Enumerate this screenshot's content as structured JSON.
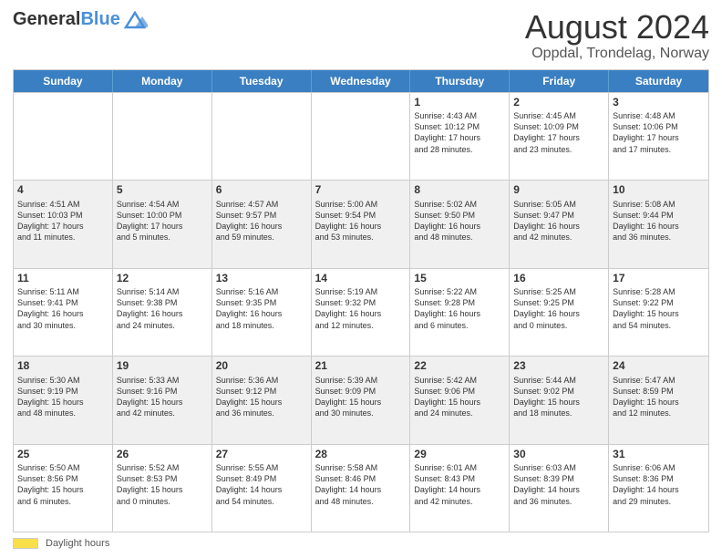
{
  "header": {
    "logo_line1": "General",
    "logo_line2": "Blue",
    "title": "August 2024",
    "subtitle": "Oppdal, Trondelag, Norway"
  },
  "days_of_week": [
    "Sunday",
    "Monday",
    "Tuesday",
    "Wednesday",
    "Thursday",
    "Friday",
    "Saturday"
  ],
  "footer": {
    "swatch_label": "Daylight hours"
  },
  "weeks": [
    [
      {
        "num": "",
        "info": ""
      },
      {
        "num": "",
        "info": ""
      },
      {
        "num": "",
        "info": ""
      },
      {
        "num": "",
        "info": ""
      },
      {
        "num": "1",
        "info": "Sunrise: 4:43 AM\nSunset: 10:12 PM\nDaylight: 17 hours\nand 28 minutes."
      },
      {
        "num": "2",
        "info": "Sunrise: 4:45 AM\nSunset: 10:09 PM\nDaylight: 17 hours\nand 23 minutes."
      },
      {
        "num": "3",
        "info": "Sunrise: 4:48 AM\nSunset: 10:06 PM\nDaylight: 17 hours\nand 17 minutes."
      }
    ],
    [
      {
        "num": "4",
        "info": "Sunrise: 4:51 AM\nSunset: 10:03 PM\nDaylight: 17 hours\nand 11 minutes."
      },
      {
        "num": "5",
        "info": "Sunrise: 4:54 AM\nSunset: 10:00 PM\nDaylight: 17 hours\nand 5 minutes."
      },
      {
        "num": "6",
        "info": "Sunrise: 4:57 AM\nSunset: 9:57 PM\nDaylight: 16 hours\nand 59 minutes."
      },
      {
        "num": "7",
        "info": "Sunrise: 5:00 AM\nSunset: 9:54 PM\nDaylight: 16 hours\nand 53 minutes."
      },
      {
        "num": "8",
        "info": "Sunrise: 5:02 AM\nSunset: 9:50 PM\nDaylight: 16 hours\nand 48 minutes."
      },
      {
        "num": "9",
        "info": "Sunrise: 5:05 AM\nSunset: 9:47 PM\nDaylight: 16 hours\nand 42 minutes."
      },
      {
        "num": "10",
        "info": "Sunrise: 5:08 AM\nSunset: 9:44 PM\nDaylight: 16 hours\nand 36 minutes."
      }
    ],
    [
      {
        "num": "11",
        "info": "Sunrise: 5:11 AM\nSunset: 9:41 PM\nDaylight: 16 hours\nand 30 minutes."
      },
      {
        "num": "12",
        "info": "Sunrise: 5:14 AM\nSunset: 9:38 PM\nDaylight: 16 hours\nand 24 minutes."
      },
      {
        "num": "13",
        "info": "Sunrise: 5:16 AM\nSunset: 9:35 PM\nDaylight: 16 hours\nand 18 minutes."
      },
      {
        "num": "14",
        "info": "Sunrise: 5:19 AM\nSunset: 9:32 PM\nDaylight: 16 hours\nand 12 minutes."
      },
      {
        "num": "15",
        "info": "Sunrise: 5:22 AM\nSunset: 9:28 PM\nDaylight: 16 hours\nand 6 minutes."
      },
      {
        "num": "16",
        "info": "Sunrise: 5:25 AM\nSunset: 9:25 PM\nDaylight: 16 hours\nand 0 minutes."
      },
      {
        "num": "17",
        "info": "Sunrise: 5:28 AM\nSunset: 9:22 PM\nDaylight: 15 hours\nand 54 minutes."
      }
    ],
    [
      {
        "num": "18",
        "info": "Sunrise: 5:30 AM\nSunset: 9:19 PM\nDaylight: 15 hours\nand 48 minutes."
      },
      {
        "num": "19",
        "info": "Sunrise: 5:33 AM\nSunset: 9:16 PM\nDaylight: 15 hours\nand 42 minutes."
      },
      {
        "num": "20",
        "info": "Sunrise: 5:36 AM\nSunset: 9:12 PM\nDaylight: 15 hours\nand 36 minutes."
      },
      {
        "num": "21",
        "info": "Sunrise: 5:39 AM\nSunset: 9:09 PM\nDaylight: 15 hours\nand 30 minutes."
      },
      {
        "num": "22",
        "info": "Sunrise: 5:42 AM\nSunset: 9:06 PM\nDaylight: 15 hours\nand 24 minutes."
      },
      {
        "num": "23",
        "info": "Sunrise: 5:44 AM\nSunset: 9:02 PM\nDaylight: 15 hours\nand 18 minutes."
      },
      {
        "num": "24",
        "info": "Sunrise: 5:47 AM\nSunset: 8:59 PM\nDaylight: 15 hours\nand 12 minutes."
      }
    ],
    [
      {
        "num": "25",
        "info": "Sunrise: 5:50 AM\nSunset: 8:56 PM\nDaylight: 15 hours\nand 6 minutes."
      },
      {
        "num": "26",
        "info": "Sunrise: 5:52 AM\nSunset: 8:53 PM\nDaylight: 15 hours\nand 0 minutes."
      },
      {
        "num": "27",
        "info": "Sunrise: 5:55 AM\nSunset: 8:49 PM\nDaylight: 14 hours\nand 54 minutes."
      },
      {
        "num": "28",
        "info": "Sunrise: 5:58 AM\nSunset: 8:46 PM\nDaylight: 14 hours\nand 48 minutes."
      },
      {
        "num": "29",
        "info": "Sunrise: 6:01 AM\nSunset: 8:43 PM\nDaylight: 14 hours\nand 42 minutes."
      },
      {
        "num": "30",
        "info": "Sunrise: 6:03 AM\nSunset: 8:39 PM\nDaylight: 14 hours\nand 36 minutes."
      },
      {
        "num": "31",
        "info": "Sunrise: 6:06 AM\nSunset: 8:36 PM\nDaylight: 14 hours\nand 29 minutes."
      }
    ]
  ]
}
